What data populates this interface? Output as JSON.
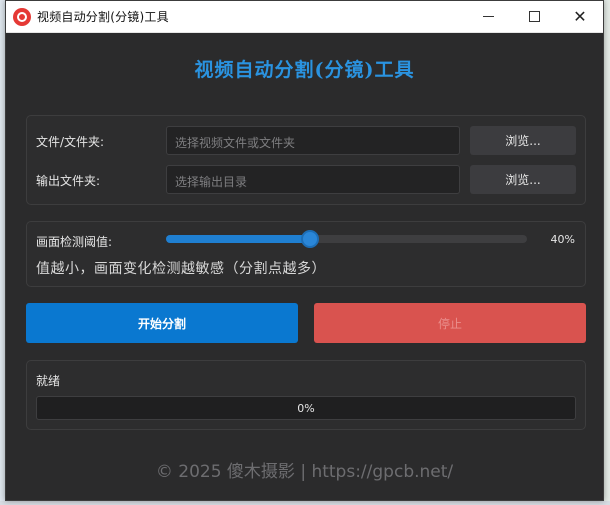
{
  "window": {
    "title": "视频自动分割(分镜)工具",
    "close_glyph": "✕"
  },
  "header": {
    "title": "视频自动分割(分镜)工具"
  },
  "files": {
    "input_label": "文件/文件夹:",
    "input_placeholder": "选择视频文件或文件夹",
    "output_label": "输出文件夹:",
    "output_placeholder": "选择输出目录",
    "browse_label": "浏览..."
  },
  "threshold": {
    "label": "画面检测阈值:",
    "value_text": "40%",
    "value_fraction": 0.4,
    "hint": "值越小，画面变化检测越敏感（分割点越多）"
  },
  "actions": {
    "start_label": "开始分割",
    "stop_label": "停止"
  },
  "status": {
    "text": "就绪",
    "progress_text": "0%",
    "progress_fraction": 0
  },
  "footer": {
    "text": "© 2025 傻木摄影 | https://gpcb.net/"
  },
  "colors": {
    "accent": "#1f7fd1",
    "title": "#2a93e0",
    "danger": "#d9534f"
  }
}
